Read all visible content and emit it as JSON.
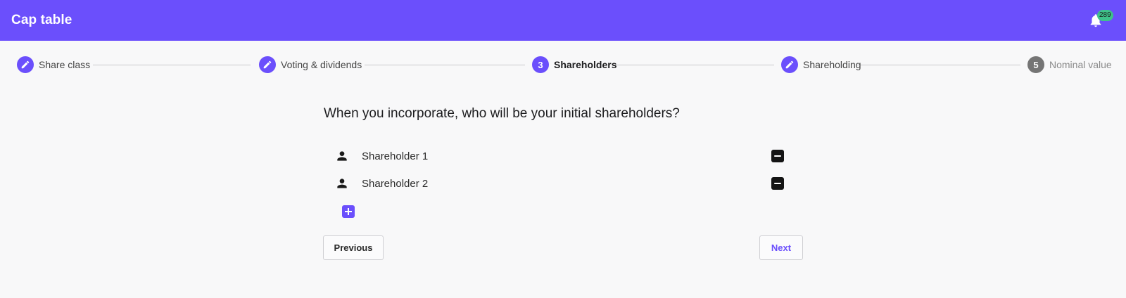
{
  "app": {
    "title": "Cap table",
    "notifications": {
      "icon": "bell-icon",
      "count": "289"
    }
  },
  "stepper": {
    "steps": [
      {
        "label": "Share class",
        "state": "edited",
        "icon": "pencil-icon"
      },
      {
        "label": "Voting & dividends",
        "state": "edited",
        "icon": "pencil-icon"
      },
      {
        "label": "Shareholders",
        "state": "current",
        "number": "3"
      },
      {
        "label": "Shareholding",
        "state": "edited",
        "icon": "pencil-icon"
      },
      {
        "label": "Nominal value",
        "state": "pending",
        "number": "5"
      }
    ]
  },
  "main": {
    "question": "When you incorporate, who will be your initial shareholders?",
    "shareholders": [
      {
        "name": "Shareholder 1",
        "icon": "person-icon",
        "remove_icon": "minus-box-icon"
      },
      {
        "name": "Shareholder 2",
        "icon": "person-icon",
        "remove_icon": "minus-box-icon"
      }
    ],
    "add_icon": "plus-box-icon",
    "previous_label": "Previous",
    "next_label": "Next"
  },
  "colors": {
    "brand": "#6b4ffc",
    "badge": "#3ec28a",
    "inactive_step": "#757575"
  }
}
